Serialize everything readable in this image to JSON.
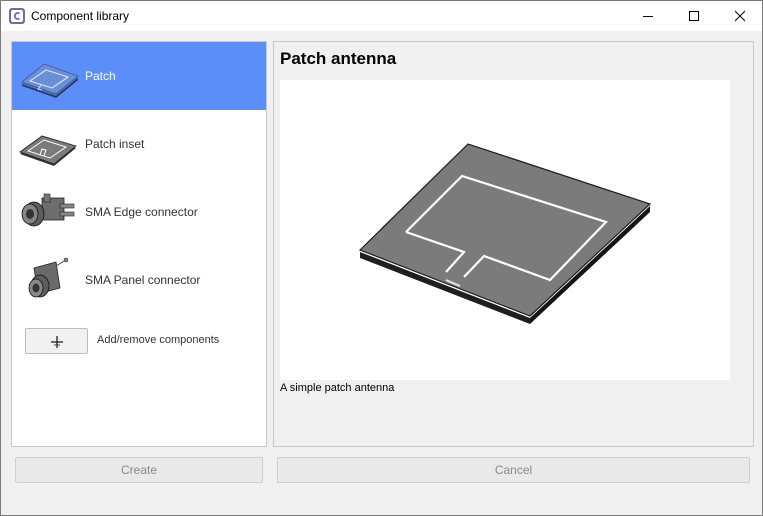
{
  "window": {
    "title": "Component library",
    "icon": "app-logo-icon"
  },
  "components": [
    {
      "label": "Patch",
      "icon": "patch-thumbnail",
      "selected": true
    },
    {
      "label": "Patch inset",
      "icon": "patch-inset-thumbnail",
      "selected": false
    },
    {
      "label": "SMA Edge connector",
      "icon": "sma-edge-connector-thumbnail",
      "selected": false
    },
    {
      "label": "SMA Panel connector",
      "icon": "sma-panel-connector-thumbnail",
      "selected": false
    }
  ],
  "add_remove": {
    "label": "Add/remove components",
    "icon": "plus-icon"
  },
  "preview": {
    "title": "Patch antenna",
    "description": "A simple patch antenna"
  },
  "buttons": {
    "create": "Create",
    "cancel": "Cancel"
  },
  "colors": {
    "selection": "#5b8ef8",
    "substrate": "#7b7b7b",
    "trace": "#ffffff"
  }
}
